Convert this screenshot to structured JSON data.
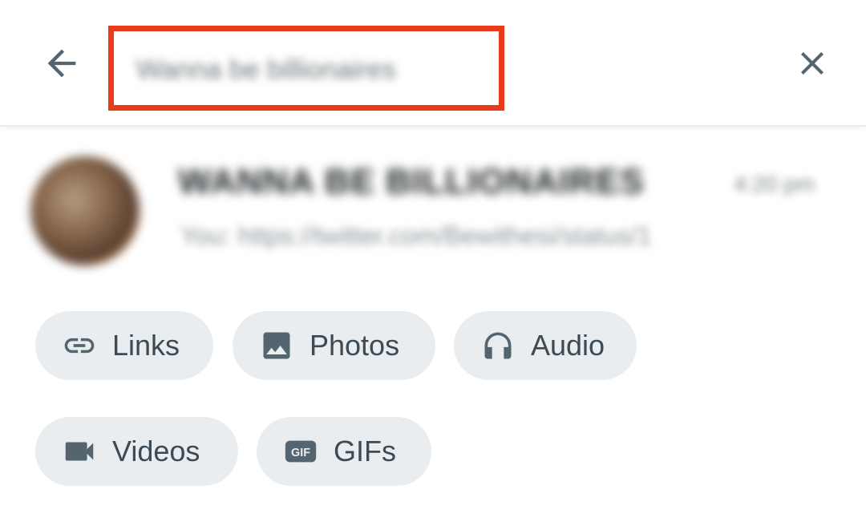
{
  "colors": {
    "highlight_border": "#ea3a1c",
    "chip_background": "#e9edef",
    "icon_color": "#54656f",
    "text_color": "#3b4a54"
  },
  "header": {
    "back_icon": "arrow-left-icon",
    "search_value": "Wanna be billionaires",
    "close_icon": "close-icon"
  },
  "chat": {
    "name": "WANNA BE BILLIONAIRES",
    "time": "4:20 pm",
    "preview": "You: https://twitter.com/Bewithesi/status/1"
  },
  "chips": [
    {
      "label": "Links",
      "icon": "link-icon"
    },
    {
      "label": "Photos",
      "icon": "photo-icon"
    },
    {
      "label": "Audio",
      "icon": "headphones-icon"
    },
    {
      "label": "Videos",
      "icon": "video-camera-icon"
    },
    {
      "label": "GIFs",
      "icon": "gif-icon"
    }
  ]
}
